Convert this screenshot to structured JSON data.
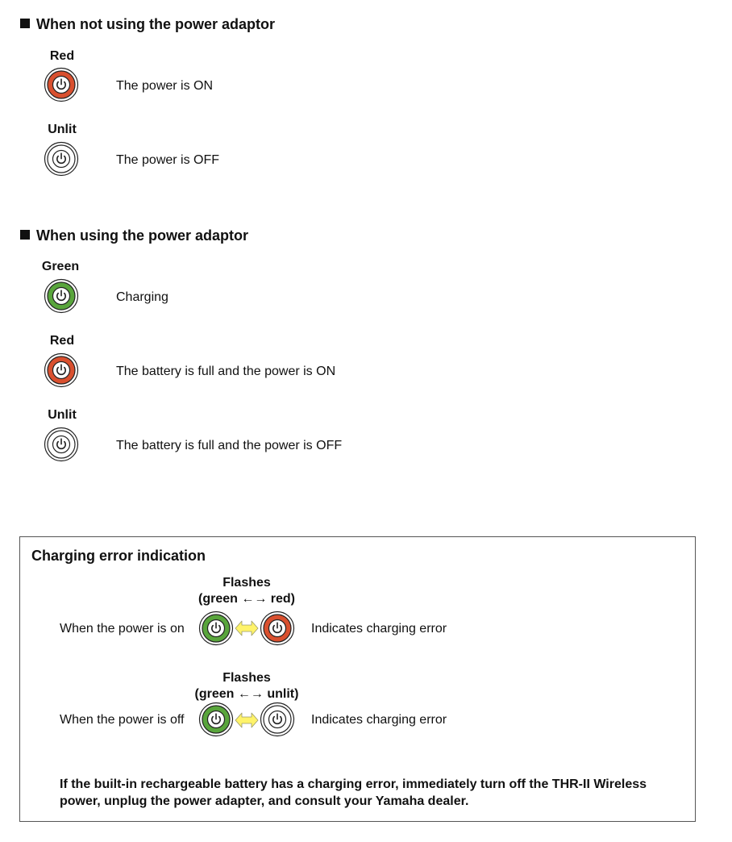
{
  "section_no_adaptor": {
    "title": "When not using the power adaptor",
    "rows": [
      {
        "label": "Red",
        "state": "red",
        "description": "The power is ON"
      },
      {
        "label": "Unlit",
        "state": "unlit",
        "description": "The power is OFF"
      }
    ]
  },
  "section_adaptor": {
    "title": "When using the power adaptor",
    "rows": [
      {
        "label": "Green",
        "state": "green",
        "description": "Charging"
      },
      {
        "label": "Red",
        "state": "red",
        "description": "The battery is full and the power is ON"
      },
      {
        "label": "Unlit",
        "state": "unlit",
        "description": "The battery is full and the power is OFF"
      }
    ]
  },
  "error_box": {
    "title": "Charging error indication",
    "cases": [
      {
        "condition": "When the power is on",
        "flash_label_line1": "Flashes",
        "flash_label_line2": "(green ←→ red)",
        "from_state": "green",
        "to_state": "red",
        "result": "Indicates charging error"
      },
      {
        "condition": "When the power is off",
        "flash_label_line1": "Flashes",
        "flash_label_line2": "(green ←→ unlit)",
        "from_state": "green",
        "to_state": "unlit",
        "result": "Indicates charging error"
      }
    ],
    "note": "If the built-in rechargeable battery has a charging error, immediately turn off the THR-II Wireless power, unplug the power adapter, and consult your Yamaha dealer."
  },
  "colors": {
    "red": "#d9502f",
    "green": "#59a53c",
    "unlit": "#ffffff",
    "arrow": "#fff36a"
  },
  "icons": {
    "power": "power-icon",
    "square_bullet": "square-bullet-icon",
    "double_arrow": "double-arrow-icon"
  }
}
